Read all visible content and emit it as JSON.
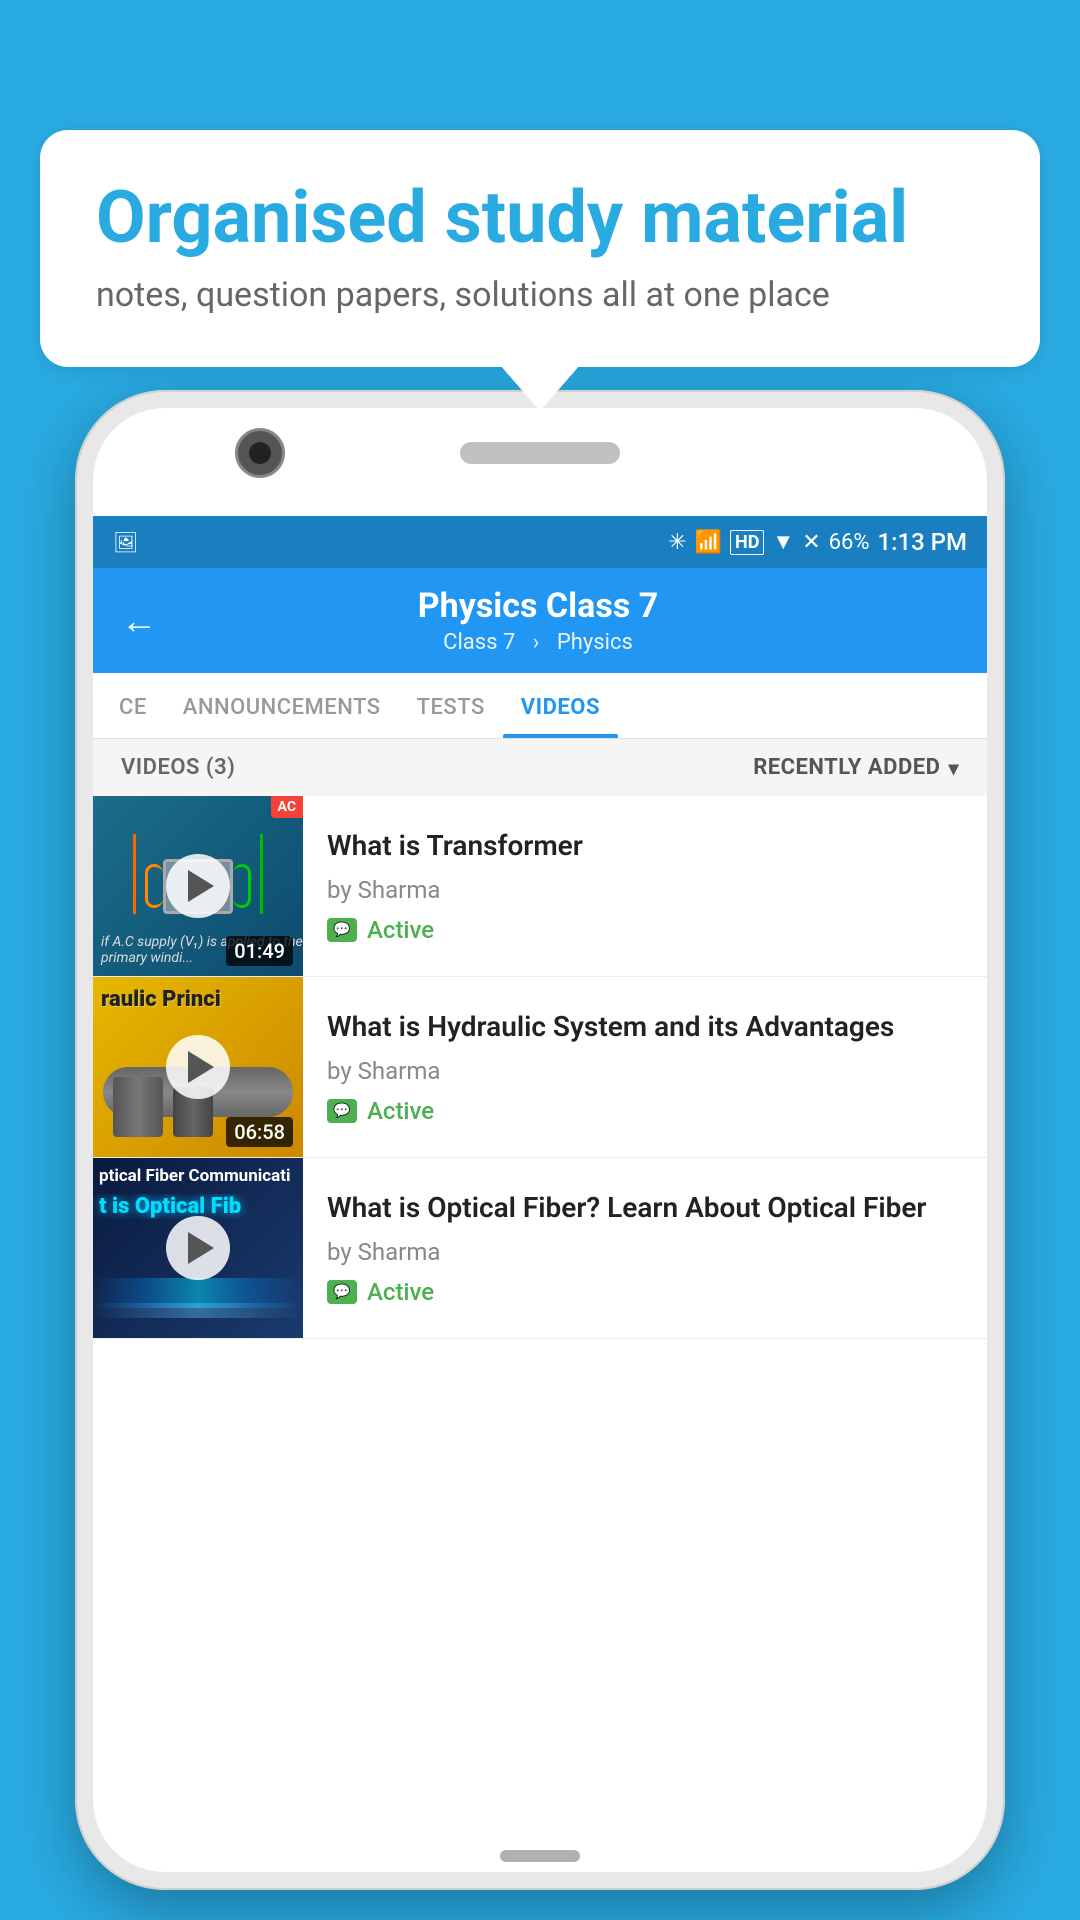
{
  "background_color": "#29abe2",
  "bubble": {
    "title": "Organised study material",
    "subtitle": "notes, question papers, solutions all at one place"
  },
  "status_bar": {
    "battery": "66%",
    "time": "1:13 PM",
    "signal_icons": "▲ HD ▼ ✕"
  },
  "header": {
    "title": "Physics Class 7",
    "breadcrumb_class": "Class 7",
    "breadcrumb_subject": "Physics",
    "back_label": "←"
  },
  "tabs": [
    {
      "label": "CE",
      "active": false
    },
    {
      "label": "ANNOUNCEMENTS",
      "active": false
    },
    {
      "label": "TESTS",
      "active": false
    },
    {
      "label": "VIDEOS",
      "active": true
    }
  ],
  "filter_bar": {
    "count_label": "VIDEOS (3)",
    "sort_label": "RECENTLY ADDED",
    "dropdown_icon": "▾"
  },
  "videos": [
    {
      "title": "What is  Transformer",
      "author": "by Sharma",
      "status": "Active",
      "duration": "01:49",
      "thumbnail_type": "transformer",
      "thumbnail_text": "AC",
      "corner_badge": "AC"
    },
    {
      "title": "What is Hydraulic System and its Advantages",
      "author": "by Sharma",
      "status": "Active",
      "duration": "06:58",
      "thumbnail_type": "hydraulic",
      "thumbnail_text": "raulic Princi"
    },
    {
      "title": "What is Optical Fiber? Learn About Optical Fiber",
      "author": "by Sharma",
      "status": "Active",
      "duration": "",
      "thumbnail_type": "optical",
      "thumbnail_text_top": "ptical Fiber Communicati",
      "thumbnail_text_bottom": "t is Optical Fib"
    }
  ],
  "icons": {
    "play": "▶",
    "chat": "💬",
    "back": "←"
  }
}
